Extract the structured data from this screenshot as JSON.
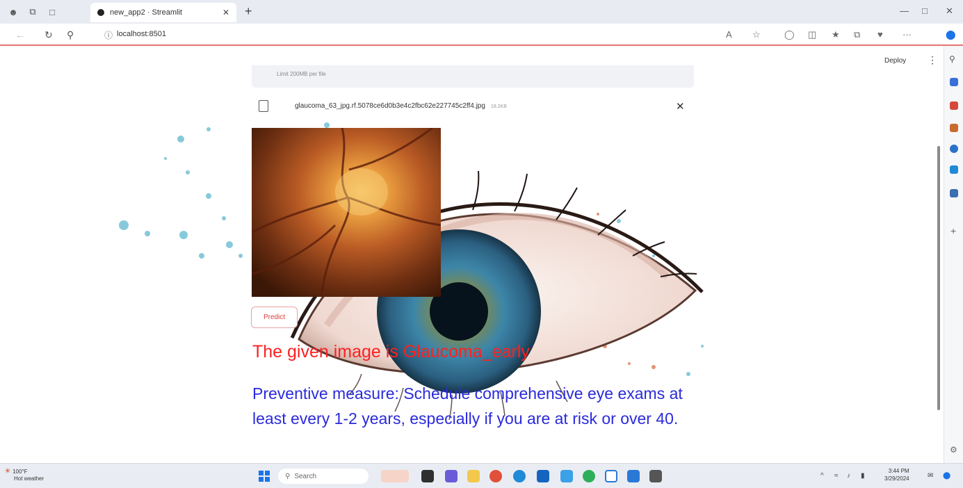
{
  "browser": {
    "tab_title": "new_app2 · Streamlit",
    "url": "localhost:8501"
  },
  "app": {
    "deploy_label": "Deploy",
    "uploader_limit_text": "Limit 200MB per file",
    "file_name": "glaucoma_63_jpg.rf.5078ce6d0b3e4c2fbc62e227745c2ff4.jpg",
    "file_size": "18.2KB",
    "predict_label": "Predict",
    "result_text": "The given image is Glaucoma_early",
    "measure_text": "Preventive measure: Schedule comprehensive eye exams at least every 1-2 years, especially if you are at risk or over 40."
  },
  "taskbar": {
    "weather_temp": "100°F",
    "weather_desc": "Hot weather",
    "search_placeholder": "Search",
    "time": "3:44 PM",
    "date": "3/29/2024"
  },
  "colors": {
    "result": "#ff2020",
    "measure": "#2a2adc",
    "accent_line": "#e57373"
  }
}
